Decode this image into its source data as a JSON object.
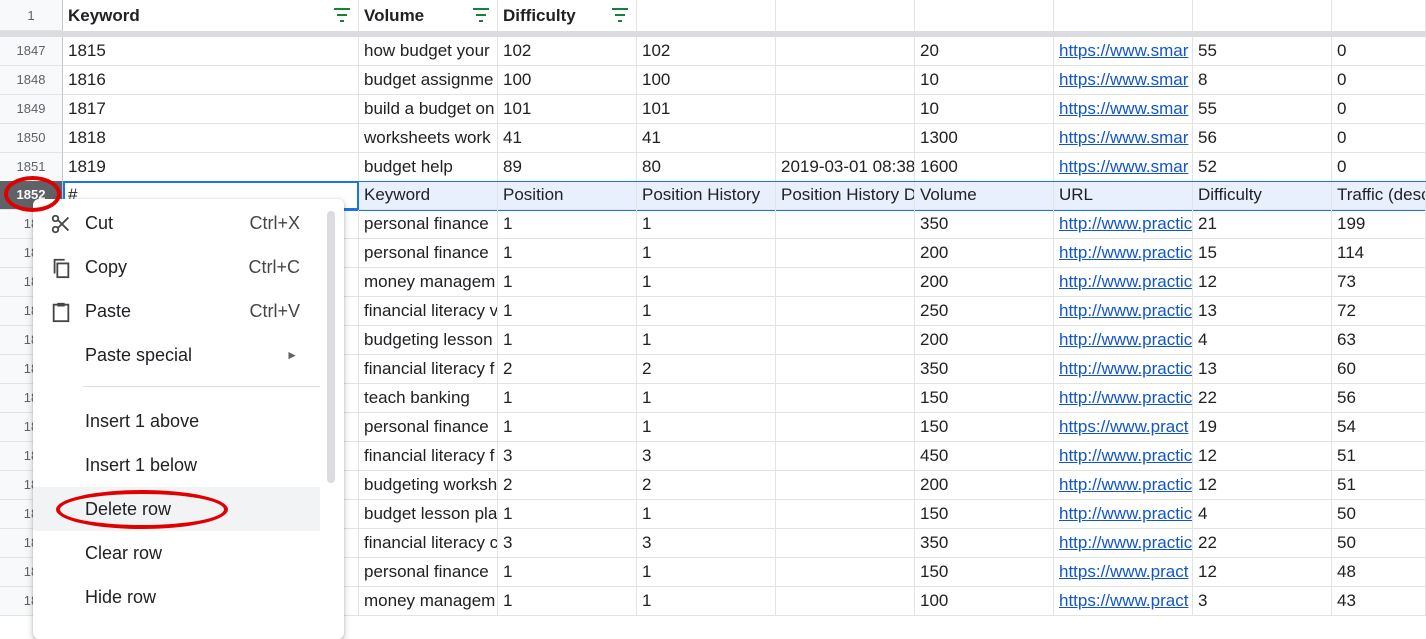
{
  "header": {
    "row_number": "1",
    "columns": [
      "Keyword",
      "Volume",
      "Difficulty",
      "",
      "",
      "",
      "",
      "",
      ""
    ]
  },
  "rows": [
    {
      "num": "1847",
      "cells": [
        "1815",
        "how budget your",
        "102",
        "102",
        "",
        "20",
        "https://www.smar",
        "55",
        "0"
      ]
    },
    {
      "num": "1848",
      "cells": [
        "1816",
        "budget assignme",
        "100",
        "100",
        "",
        "10",
        "https://www.smar",
        "8",
        "0"
      ]
    },
    {
      "num": "1849",
      "cells": [
        "1817",
        "build a budget on",
        "101",
        "101",
        "",
        "10",
        "https://www.smar",
        "55",
        "0"
      ]
    },
    {
      "num": "1850",
      "cells": [
        "1818",
        "worksheets work",
        "41",
        "41",
        "",
        "1300",
        "https://www.smar",
        "56",
        "0"
      ]
    },
    {
      "num": "1851",
      "cells": [
        "1819",
        "budget help",
        "89",
        "80",
        "2019-03-01 08:38",
        "1600",
        "https://www.smar",
        "52",
        "0"
      ]
    }
  ],
  "selected_row": {
    "num": "1852",
    "cells": [
      "#",
      "Keyword",
      "Position",
      "Position History",
      "Position History D",
      "Volume",
      "URL",
      "Difficulty",
      "Traffic (desc"
    ]
  },
  "lower_rows": [
    {
      "num": "18",
      "cells": [
        "",
        "personal finance",
        "1",
        "1",
        "",
        "350",
        "http://www.practic",
        "21",
        "199"
      ]
    },
    {
      "num": "18",
      "cells": [
        "",
        "personal finance",
        "1",
        "1",
        "",
        "200",
        "http://www.practic",
        "15",
        "114"
      ]
    },
    {
      "num": "18",
      "cells": [
        "",
        "money managem",
        "1",
        "1",
        "",
        "200",
        "http://www.practic",
        "12",
        "73"
      ]
    },
    {
      "num": "18",
      "cells": [
        "",
        "financial literacy v",
        "1",
        "1",
        "",
        "250",
        "http://www.practic",
        "13",
        "72"
      ]
    },
    {
      "num": "18",
      "cells": [
        "",
        "budgeting lesson",
        "1",
        "1",
        "",
        "200",
        "http://www.practic",
        "4",
        "63"
      ]
    },
    {
      "num": "18",
      "cells": [
        "",
        "financial literacy f",
        "2",
        "2",
        "",
        "350",
        "http://www.practic",
        "13",
        "60"
      ]
    },
    {
      "num": "18",
      "cells": [
        "",
        "teach banking",
        "1",
        "1",
        "",
        "150",
        "http://www.practic",
        "22",
        "56"
      ]
    },
    {
      "num": "18",
      "cells": [
        "",
        "personal finance",
        "1",
        "1",
        "",
        "150",
        "https://www.pract",
        "19",
        "54"
      ]
    },
    {
      "num": "18",
      "cells": [
        "",
        "financial literacy f",
        "3",
        "3",
        "",
        "450",
        "http://www.practic",
        "12",
        "51"
      ]
    },
    {
      "num": "18",
      "cells": [
        "",
        "budgeting worksh",
        "2",
        "2",
        "",
        "200",
        "http://www.practic",
        "12",
        "51"
      ]
    },
    {
      "num": "18",
      "cells": [
        "",
        "budget lesson pla",
        "1",
        "1",
        "",
        "150",
        "http://www.practic",
        "4",
        "50"
      ]
    },
    {
      "num": "18",
      "cells": [
        "",
        "financial literacy c",
        "3",
        "3",
        "",
        "350",
        "http://www.practic",
        "22",
        "50"
      ]
    },
    {
      "num": "18",
      "cells": [
        "",
        "personal finance",
        "1",
        "1",
        "",
        "150",
        "https://www.pract",
        "12",
        "48"
      ]
    },
    {
      "num": "18",
      "cells": [
        "",
        "money managem",
        "1",
        "1",
        "",
        "100",
        "https://www.pract",
        "3",
        "43"
      ]
    }
  ],
  "context_menu": {
    "cut": {
      "label": "Cut",
      "shortcut": "Ctrl+X"
    },
    "copy": {
      "label": "Copy",
      "shortcut": "Ctrl+C"
    },
    "paste": {
      "label": "Paste",
      "shortcut": "Ctrl+V"
    },
    "paste_special": {
      "label": "Paste special",
      "arrow": "►"
    },
    "insert_above": {
      "label": "Insert 1 above"
    },
    "insert_below": {
      "label": "Insert 1 below"
    },
    "delete_row": {
      "label": "Delete row"
    },
    "clear_row": {
      "label": "Clear row"
    },
    "hide_row": {
      "label": "Hide row"
    }
  },
  "colors": {
    "accent": "#1a73e8",
    "link": "#1155cc",
    "annotation": "#e00000",
    "filter_icon": "#188038"
  }
}
